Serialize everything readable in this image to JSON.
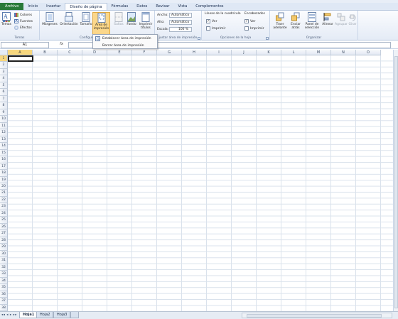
{
  "ribbon_tabs": [
    "Archivo",
    "Inicio",
    "Insertar",
    "Diseño de página",
    "Fórmulas",
    "Datos",
    "Revisar",
    "Vista",
    "Complementos"
  ],
  "active_tab_index": 3,
  "colors": {
    "file_tab": "#2a7a39",
    "active_cell_header": "#f7d77e",
    "pressed_button": "#fbd78a"
  },
  "groups": {
    "temas": {
      "label": "Temas",
      "temas_button": "Temas",
      "colores": "Colores",
      "fuentes": "Fuentes",
      "efectos": "Efectos"
    },
    "configurar": {
      "label": "Configurar página",
      "label_visible": "Configur",
      "margenes": "Márgenes",
      "orientacion": "Orientación",
      "tamano": "Tamaño",
      "area_line1": "Área de",
      "area_line2": "impresión",
      "saltos": "Saltos",
      "fondo": "Fondo",
      "imprimir_line1": "Imprimir",
      "imprimir_line2": "títulos"
    },
    "ajustar": {
      "label": "Ajustar área de impresión",
      "label_visible": "justar área de impresión",
      "ancho_label": "Ancho:",
      "ancho_value": "Automático",
      "alto_label": "Alto:",
      "alto_value": "Automático",
      "escala_label": "Escala:",
      "escala_value": "100 %"
    },
    "opciones": {
      "label": "Opciones de la hoja",
      "lineas_title": "Líneas de la cuadrícula",
      "encabezados_title": "Encabezados",
      "ver": "Ver",
      "imprimir": "Imprimir"
    },
    "organizar": {
      "label": "Organizar",
      "traer_line1": "Traer",
      "traer_line2": "adelante",
      "enviar_line1": "Enviar",
      "enviar_line2": "atrás",
      "panel_line1": "Panel de",
      "panel_line2": "selección",
      "alinear": "Alinear",
      "agrupar": "Agrupar",
      "girar": "Girar"
    }
  },
  "dropdown_menu": {
    "items": [
      "Establecer área de impresión",
      "Borrar área de impresión"
    ]
  },
  "formula_bar": {
    "name_box": "A1",
    "fx_label": "fx",
    "formula": ""
  },
  "columns": [
    "A",
    "B",
    "C",
    "D",
    "E",
    "F",
    "G",
    "H",
    "I",
    "J",
    "K",
    "L",
    "M",
    "N",
    "O"
  ],
  "rows": [
    "1",
    "2",
    "3",
    "4",
    "5",
    "6",
    "7",
    "8",
    "9",
    "10",
    "11",
    "12",
    "13",
    "14",
    "15",
    "16",
    "17",
    "18",
    "19",
    "20",
    "21",
    "22",
    "23",
    "24",
    "25",
    "26",
    "27",
    "28",
    "29",
    "30",
    "31",
    "32",
    "33",
    "34",
    "35",
    "36",
    "37",
    "38"
  ],
  "active_cell": "A1",
  "sheet_tabs": [
    "Hoja1",
    "Hoja2",
    "Hoja3"
  ],
  "active_sheet_index": 0
}
